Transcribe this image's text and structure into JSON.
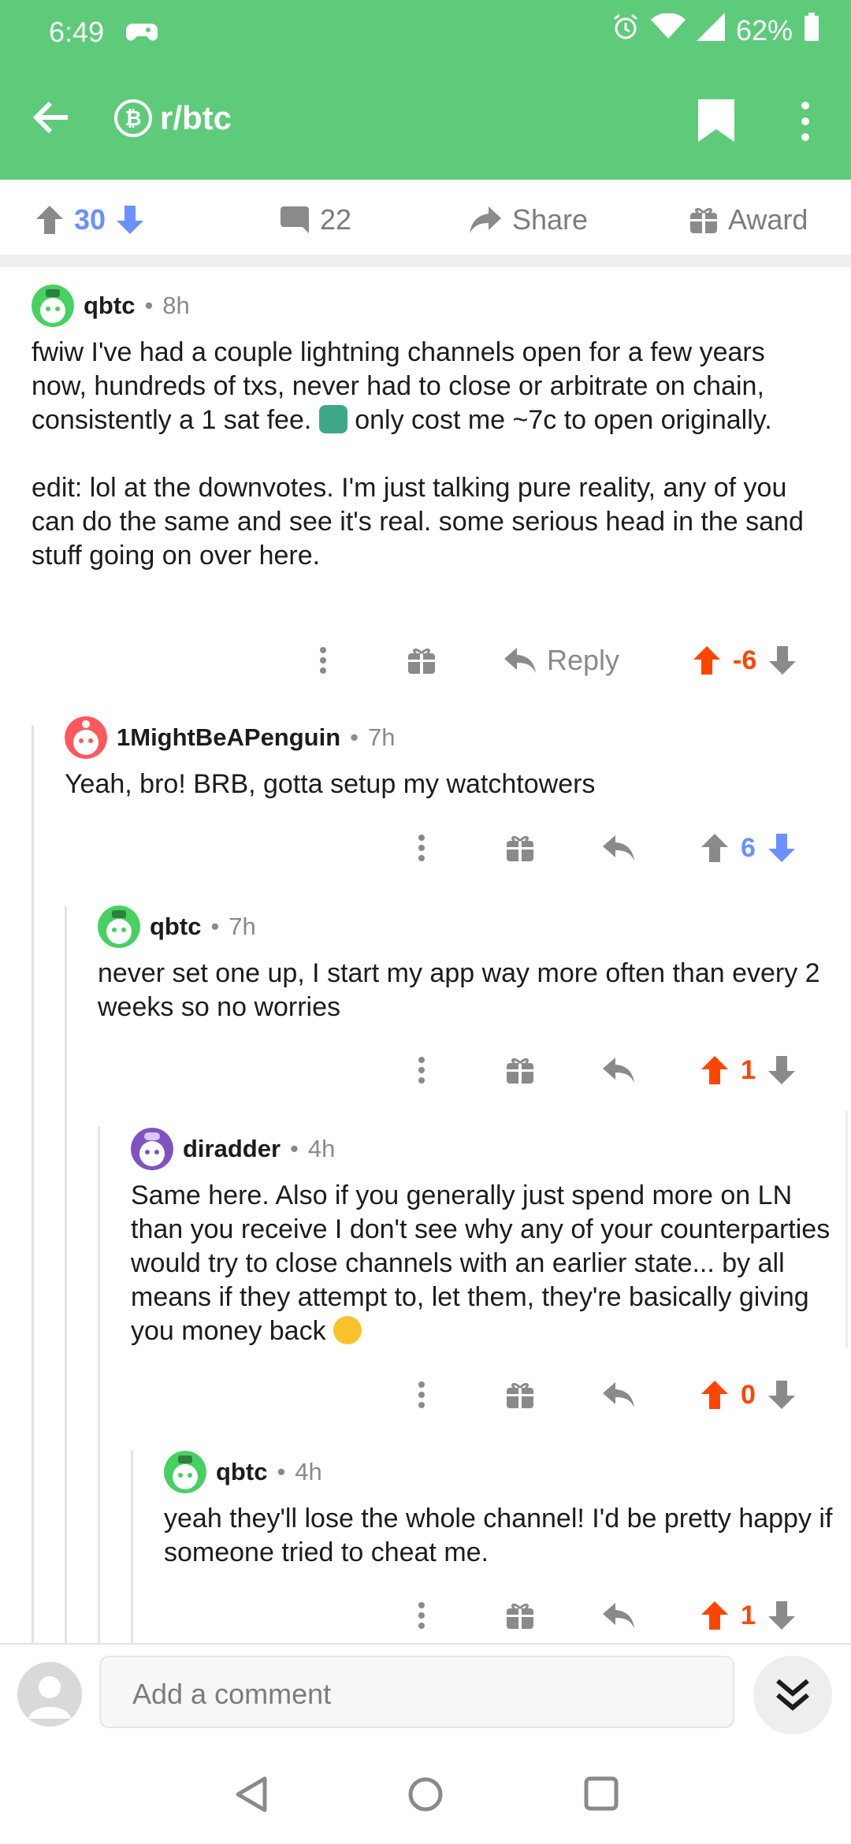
{
  "status_bar": {
    "time": "6:49",
    "battery": "62%"
  },
  "app_bar": {
    "subreddit": "r/btc"
  },
  "post_bar": {
    "score": "30",
    "comments": "22",
    "share_label": "Share",
    "award_label": "Award"
  },
  "colors": {
    "header_green": "#5ecb7a",
    "upvote_orange": "#ff4500",
    "downvote_blue": "#6b90ff",
    "gray": "#8a8a8a"
  },
  "comments": [
    {
      "author": "qbtc",
      "age": "8h",
      "body_p1_a": "fwiw I've had a couple lightning channels open for a few years now, hundreds of txs, never had to close or arbitrate on chain, consistently a 1 sat fee. ",
      "body_p1_emoji": "person-shrugging-emoji",
      "body_p1_b": " only cost me ~7c to open originally.",
      "body_p2": "edit: lol at the downvotes. I'm just talking pure reality, any of you can do the same and see it's real. some serious head in the sand stuff going on over here.",
      "reply_label": "Reply",
      "score": "-6",
      "vote": "up"
    },
    {
      "author": "1MightBeAPenguin",
      "age": "7h",
      "body": "Yeah, bro! BRB, gotta setup my watchtowers",
      "score": "6",
      "vote": "down"
    },
    {
      "author": "qbtc",
      "age": "7h",
      "body": "never set one up, I start my app way more often than every 2 weeks so no worries",
      "score": "1",
      "vote": "up"
    },
    {
      "author": "diradder",
      "age": "4h",
      "body": "Same here. Also if you generally just spend more on LN than you receive I don't see why any of your counterparties would try to close channels with an earlier state... by all means if they attempt to, let them, they're basically giving you money back ",
      "emoji": "laughing-tears-emoji",
      "score": "0",
      "vote": "up"
    },
    {
      "author": "qbtc",
      "age": "4h",
      "body": "yeah they'll lose the whole channel! I'd be pretty happy if someone tried to cheat me.",
      "score": "1",
      "vote": "up"
    }
  ],
  "compose": {
    "placeholder": "Add a comment"
  }
}
